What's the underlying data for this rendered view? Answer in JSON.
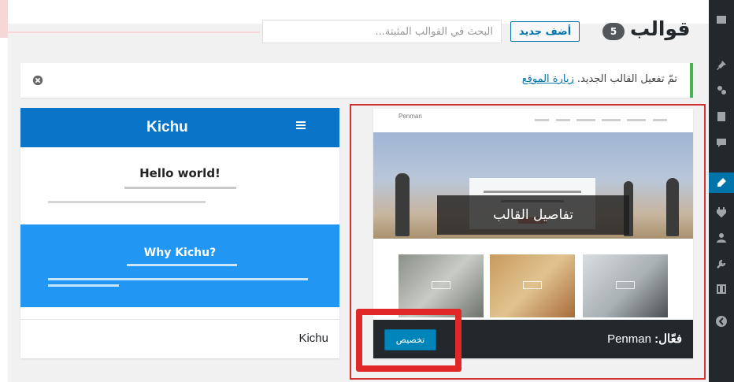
{
  "header": {
    "title": "قوالب",
    "count": "5",
    "add_new_label": "أضف جديد",
    "search_placeholder": "البحث في القوالب المثبتة..."
  },
  "notice": {
    "message": "تمّ تفعيل القالب الجديد.",
    "link_label": "زيارة الموقع"
  },
  "themes": {
    "kichu": {
      "name": "Kichu",
      "preview_logo": "Kichu",
      "preview_post1": "Hello world!",
      "preview_post2": "Why Kichu?"
    },
    "penman": {
      "preview_logo": "Penman",
      "active_prefix": "فعّال:",
      "active_name": "Penman",
      "details_label": "تفاصيل القالب",
      "customize_label": "تخصيص"
    }
  },
  "sidebar": {
    "icons": [
      "pin-icon",
      "media-icon",
      "pages-icon",
      "comments-icon",
      "appearance-icon",
      "plugins-icon",
      "users-icon",
      "tools-icon",
      "settings-icon",
      "collapse-icon"
    ]
  },
  "colors": {
    "admin_dark": "#23282d",
    "accent_blue": "#0073aa",
    "success_green": "#46b450",
    "annotation_red": "#d23131"
  }
}
